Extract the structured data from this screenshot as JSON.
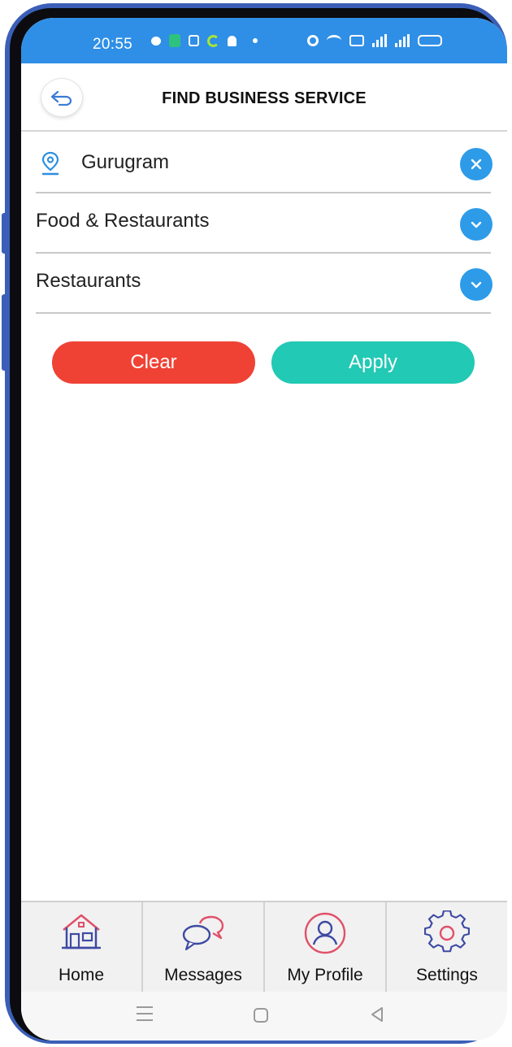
{
  "status_bar": {
    "time": "20:55"
  },
  "header": {
    "title": "FIND BUSINESS SERVICE",
    "back_icon": "back-arrow-icon"
  },
  "filters": {
    "location": "Gurugram",
    "category": "Food & Restaurants",
    "subcategory": "Restaurants"
  },
  "actions": {
    "clear_label": "Clear",
    "apply_label": "Apply"
  },
  "bottom_nav": {
    "items": [
      {
        "label": "Home",
        "icon": "home-icon"
      },
      {
        "label": "Messages",
        "icon": "chat-bubbles-icon"
      },
      {
        "label": "My Profile",
        "icon": "user-profile-icon"
      },
      {
        "label": "Settings",
        "icon": "gear-icon"
      }
    ]
  },
  "colors": {
    "status_bar": "#2f8fe6",
    "accent_blue": "#2d9be8",
    "clear_red": "#ef4235",
    "apply_teal": "#22c9b4",
    "phone_frame": "#3b5fb8"
  }
}
